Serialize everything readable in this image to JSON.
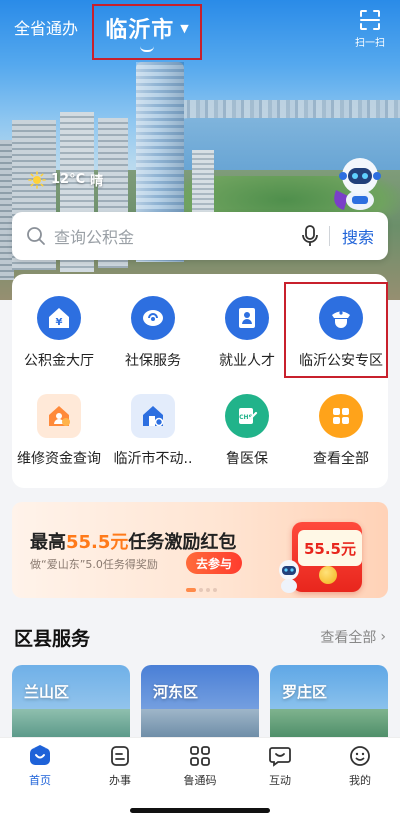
{
  "header": {
    "region_link": "全省通办",
    "city": "临沂市",
    "scan_label": "扫一扫"
  },
  "weather": {
    "temp": "12°C",
    "condition": "晴"
  },
  "search": {
    "placeholder": "查询公积金",
    "button": "搜索"
  },
  "services": [
    {
      "label": "公积金大厅",
      "icon": "housing-fund-icon",
      "color": "#2d6fe0"
    },
    {
      "label": "社保服务",
      "icon": "social-security-icon",
      "color": "#2d6fe0"
    },
    {
      "label": "就业人才",
      "icon": "employment-icon",
      "color": "#2d6fe0"
    },
    {
      "label": "临沂公安专区",
      "icon": "police-icon",
      "color": "#2d6fe0"
    },
    {
      "label": "维修资金查询",
      "icon": "repair-fund-icon",
      "color": "#ff8a3a"
    },
    {
      "label": "临沂市不动..",
      "icon": "real-estate-icon",
      "color": "#2d6fe0"
    },
    {
      "label": "鲁医保",
      "icon": "medical-insurance-icon",
      "color": "#21b38a"
    },
    {
      "label": "查看全部",
      "icon": "all-apps-icon",
      "color": "#ffa31a"
    }
  ],
  "banner": {
    "prefix": "最高",
    "amount": "55.5元",
    "suffix": "任务激励红包",
    "subtitle": "做“爱山东”5.0任务得奖励",
    "cta": "去参与",
    "card_text": "55.5元"
  },
  "district": {
    "title": "区县服务",
    "view_all": "查看全部",
    "items": [
      {
        "name": "兰山区"
      },
      {
        "name": "河东区"
      },
      {
        "name": "罗庄区"
      }
    ]
  },
  "tabs": [
    {
      "label": "首页",
      "icon": "home-icon",
      "active": true
    },
    {
      "label": "办事",
      "icon": "tasks-icon",
      "active": false
    },
    {
      "label": "鲁通码",
      "icon": "qr-code-icon",
      "active": false
    },
    {
      "label": "互动",
      "icon": "chat-icon",
      "active": false
    },
    {
      "label": "我的",
      "icon": "profile-icon",
      "active": false
    }
  ],
  "colors": {
    "accent": "#1e62d8",
    "highlight_border": "#c8202c",
    "banner_orange": "#ff7a1a"
  }
}
